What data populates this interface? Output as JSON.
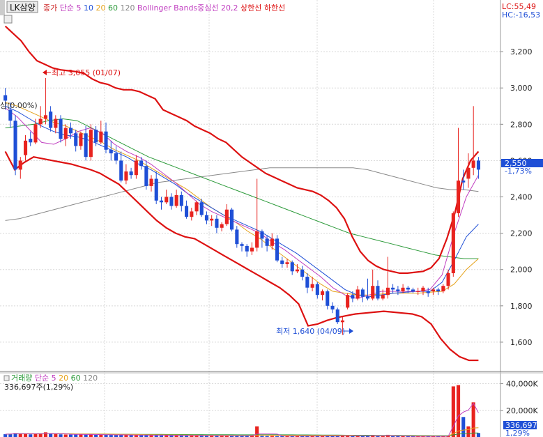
{
  "price_panel": {
    "stock_name": "LK삼양",
    "legend": [
      {
        "text": "종가",
        "color": "#cc2222"
      },
      {
        "text": "단순",
        "color": "#c03ec0"
      },
      {
        "text": "5",
        "color": "#c03ec0"
      },
      {
        "text": "10",
        "color": "#1f4fd6"
      },
      {
        "text": "20",
        "color": "#e5a21a"
      },
      {
        "text": "60",
        "color": "#2c9a3a"
      },
      {
        "text": "120",
        "color": "#888888"
      },
      {
        "text": "Bollinger Bands중심선 20,2",
        "color": "#c03ec0"
      },
      {
        "text": "상한선",
        "color": "#dd1111"
      },
      {
        "text": "하한선",
        "color": "#dd1111"
      }
    ],
    "lc_label": "LC:55,49",
    "hc_label": "HC:-16,53",
    "cursor_label": "상(0.00%)",
    "max_annotation": "최고 3,055 (01/07)",
    "min_annotation": "최저 1,640 (04/09)",
    "current_price": "2,550",
    "current_change": "-1,73%",
    "y_ticks": [
      "3,200",
      "3,000",
      "2,800",
      "2,600",
      "2,400",
      "2,200",
      "2,000",
      "1,800",
      "1,600"
    ]
  },
  "volume_panel": {
    "legend": [
      {
        "text": "거래량",
        "color": "#2c9a3a"
      },
      {
        "text": "단순",
        "color": "#c03ec0"
      },
      {
        "text": "5",
        "color": "#c03ec0"
      },
      {
        "text": "20",
        "color": "#e5a21a"
      },
      {
        "text": "60",
        "color": "#2c9a3a"
      },
      {
        "text": "120",
        "color": "#888888"
      }
    ],
    "volume_readout": "336,697주(1,29%)",
    "y_ticks": [
      "40,000K",
      "20,000K"
    ],
    "current_volume": "336,697",
    "current_ratio": "1,29%"
  },
  "chart_data": {
    "type": "candlestick",
    "price_ylim": [
      1450,
      3400
    ],
    "volume_ylim": [
      0,
      45000
    ],
    "colors": {
      "up": "#e8231f",
      "down": "#1f4fd6",
      "ma5": "#c03ec0",
      "ma10": "#1f4fd6",
      "ma20": "#e5a21a",
      "ma60": "#2c9a3a",
      "ma120": "#888888",
      "bb_upper": "#dd1111",
      "bb_lower": "#dd1111"
    },
    "candles": [
      [
        2960,
        2930,
        3000,
        2880
      ],
      [
        2880,
        2820,
        2920,
        2780
      ],
      [
        2820,
        2550,
        2850,
        2520
      ],
      [
        2550,
        2600,
        2620,
        2500
      ],
      [
        2630,
        2710,
        2740,
        2600
      ],
      [
        2720,
        2700,
        2760,
        2680
      ],
      [
        2700,
        2800,
        2830,
        2690
      ],
      [
        2800,
        2830,
        2900,
        2780
      ],
      [
        2830,
        2850,
        3055,
        2800
      ],
      [
        2870,
        2780,
        2900,
        2760
      ],
      [
        2780,
        2830,
        2850,
        2750
      ],
      [
        2830,
        2720,
        2850,
        2700
      ],
      [
        2720,
        2780,
        2800,
        2680
      ],
      [
        2780,
        2750,
        2810,
        2720
      ],
      [
        2750,
        2680,
        2770,
        2650
      ],
      [
        2680,
        2750,
        2760,
        2660
      ],
      [
        2750,
        2620,
        2790,
        2600
      ],
      [
        2620,
        2770,
        2800,
        2600
      ],
      [
        2770,
        2700,
        2790,
        2680
      ],
      [
        2700,
        2760,
        2820,
        2690
      ],
      [
        2760,
        2660,
        2810,
        2640
      ],
      [
        2660,
        2640,
        2710,
        2600
      ],
      [
        2640,
        2600,
        2680,
        2580
      ],
      [
        2600,
        2490,
        2650,
        2480
      ],
      [
        2490,
        2540,
        2580,
        2470
      ],
      [
        2540,
        2520,
        2560,
        2500
      ],
      [
        2520,
        2600,
        2630,
        2500
      ],
      [
        2600,
        2570,
        2620,
        2550
      ],
      [
        2570,
        2460,
        2600,
        2440
      ],
      [
        2460,
        2500,
        2520,
        2430
      ],
      [
        2500,
        2380,
        2540,
        2360
      ],
      [
        2380,
        2370,
        2400,
        2330
      ],
      [
        2370,
        2400,
        2440,
        2360
      ],
      [
        2400,
        2350,
        2420,
        2330
      ],
      [
        2350,
        2410,
        2440,
        2340
      ],
      [
        2410,
        2350,
        2430,
        2320
      ],
      [
        2350,
        2290,
        2380,
        2280
      ],
      [
        2290,
        2320,
        2340,
        2270
      ],
      [
        2320,
        2370,
        2380,
        2300
      ],
      [
        2370,
        2300,
        2390,
        2290
      ],
      [
        2300,
        2270,
        2320,
        2250
      ],
      [
        2270,
        2280,
        2300,
        2240
      ],
      [
        2280,
        2230,
        2300,
        2200
      ],
      [
        2230,
        2250,
        2260,
        2210
      ],
      [
        2250,
        2330,
        2360,
        2240
      ],
      [
        2330,
        2220,
        2340,
        2210
      ],
      [
        2220,
        2140,
        2240,
        2120
      ],
      [
        2140,
        2130,
        2150,
        2100
      ],
      [
        2130,
        2100,
        2140,
        2070
      ],
      [
        2100,
        2120,
        2150,
        2080
      ],
      [
        2120,
        2210,
        2500,
        2100
      ],
      [
        2210,
        2170,
        2220,
        2120
      ],
      [
        2170,
        2130,
        2190,
        2100
      ],
      [
        2130,
        2170,
        2200,
        2110
      ],
      [
        2170,
        2050,
        2190,
        2040
      ],
      [
        2050,
        2030,
        2070,
        2010
      ],
      [
        2030,
        2040,
        2060,
        2010
      ],
      [
        2040,
        1990,
        2050,
        1970
      ],
      [
        1990,
        2000,
        2030,
        1980
      ],
      [
        2000,
        1960,
        2020,
        1940
      ],
      [
        1960,
        1900,
        1980,
        1870
      ],
      [
        1900,
        1920,
        1960,
        1880
      ],
      [
        1920,
        1860,
        1930,
        1840
      ],
      [
        1860,
        1880,
        1890,
        1830
      ],
      [
        1880,
        1800,
        1890,
        1780
      ],
      [
        1800,
        1780,
        1820,
        1760
      ],
      [
        1780,
        1710,
        1790,
        1700
      ],
      [
        1710,
        1720,
        1740,
        1640
      ],
      [
        1790,
        1860,
        1870,
        1780
      ],
      [
        1860,
        1840,
        1880,
        1820
      ],
      [
        1840,
        1890,
        1910,
        1830
      ],
      [
        1890,
        1850,
        1900,
        1820
      ],
      [
        1850,
        1840,
        1950,
        1830
      ],
      [
        1840,
        1910,
        2000,
        1830
      ],
      [
        1910,
        1840,
        1940,
        1830
      ],
      [
        1840,
        1860,
        1890,
        1830
      ],
      [
        1860,
        1900,
        2070,
        1840
      ],
      [
        1900,
        1890,
        1920,
        1870
      ],
      [
        1890,
        1880,
        1910,
        1860
      ],
      [
        1880,
        1900,
        1920,
        1870
      ],
      [
        1900,
        1890,
        1910,
        1870
      ],
      [
        1890,
        1880,
        1900,
        1870
      ],
      [
        1880,
        1880,
        1900,
        1860
      ],
      [
        1880,
        1900,
        1910,
        1860
      ],
      [
        1880,
        1870,
        1900,
        1850
      ],
      [
        1880,
        1890,
        1900,
        1860
      ],
      [
        1890,
        1880,
        1900,
        1860
      ],
      [
        1880,
        1910,
        1920,
        1870
      ],
      [
        1910,
        1980,
        2000,
        1890
      ],
      [
        1980,
        2310,
        2320,
        1960
      ],
      [
        2310,
        2490,
        2780,
        2290
      ],
      [
        2490,
        2480,
        2550,
        2440
      ],
      [
        2500,
        2560,
        2640,
        2450
      ],
      [
        2560,
        2600,
        2900,
        2520
      ],
      [
        2600,
        2550,
        2620,
        2500
      ]
    ],
    "bb_upper": [
      3340,
      3300,
      3260,
      3200,
      3150,
      3130,
      3110,
      3100,
      3095,
      3090,
      3080,
      3050,
      3030,
      3020,
      3000,
      2990,
      2990,
      2980,
      2960,
      2940,
      2880,
      2860,
      2840,
      2820,
      2790,
      2770,
      2750,
      2720,
      2700,
      2660,
      2620,
      2590,
      2560,
      2530,
      2510,
      2490,
      2470,
      2450,
      2440,
      2430,
      2410,
      2380,
      2340,
      2280,
      2180,
      2100,
      2050,
      2020,
      2000,
      1990,
      1980,
      1980,
      1985,
      1990,
      2010,
      2060,
      2170,
      2310,
      2500,
      2600,
      2650
    ],
    "bb_upper_x": [
      0,
      1,
      2,
      3,
      4,
      5,
      6,
      7,
      8,
      9,
      10,
      11,
      12,
      13,
      14,
      15,
      16,
      17,
      18,
      19,
      20,
      21,
      22,
      23,
      24,
      25,
      26,
      27,
      28,
      29,
      30,
      31,
      32,
      33,
      34,
      35,
      36,
      37,
      38,
      39,
      40,
      41,
      42,
      43,
      44,
      45,
      46,
      47,
      48,
      49,
      50,
      51,
      52,
      53,
      54,
      55,
      56,
      57,
      58,
      59,
      60
    ],
    "bb_lower": [
      2650,
      2550,
      2590,
      2620,
      2610,
      2600,
      2590,
      2580,
      2565,
      2550,
      2530,
      2500,
      2470,
      2420,
      2370,
      2320,
      2270,
      2230,
      2200,
      2180,
      2170,
      2140,
      2110,
      2080,
      2050,
      2020,
      1990,
      1960,
      1930,
      1900,
      1860,
      1810,
      1690,
      1700,
      1720,
      1735,
      1745,
      1755,
      1760,
      1765,
      1770,
      1765,
      1760,
      1755,
      1740,
      1700,
      1620,
      1560,
      1520,
      1500,
      1500
    ],
    "bb_lower_x": [
      0,
      1,
      2,
      3,
      4,
      5,
      6,
      7,
      8,
      9,
      10,
      11,
      12,
      13,
      14,
      15,
      16,
      17,
      18,
      19,
      20,
      21,
      22,
      23,
      24,
      25,
      26,
      27,
      28,
      29,
      30,
      31,
      32,
      33,
      34,
      35,
      36,
      37,
      38,
      39,
      40,
      41,
      42,
      43,
      44,
      45,
      46,
      47,
      48,
      49,
      50
    ],
    "ma5": [
      2890,
      2840,
      2770,
      2700,
      2690,
      2720,
      2760,
      2780,
      2750,
      2690,
      2650,
      2620,
      2580,
      2530,
      2480,
      2420,
      2360,
      2320,
      2290,
      2260,
      2230,
      2200,
      2150,
      2110,
      2060,
      2010,
      1960,
      1900,
      1860,
      1840,
      1860,
      1880,
      1880,
      1880,
      1880,
      1890,
      1970,
      2200,
      2400,
      2520
    ],
    "ma10": [
      2900,
      2870,
      2830,
      2790,
      2760,
      2740,
      2730,
      2710,
      2680,
      2650,
      2620,
      2580,
      2550,
      2510,
      2470,
      2420,
      2380,
      2340,
      2300,
      2270,
      2240,
      2210,
      2170,
      2130,
      2090,
      2040,
      1990,
      1940,
      1890,
      1860,
      1850,
      1860,
      1870,
      1875,
      1880,
      1880,
      1930,
      2050,
      2180,
      2250
    ],
    "ma20": [
      2920,
      2900,
      2870,
      2840,
      2810,
      2790,
      2760,
      2730,
      2700,
      2660,
      2630,
      2600,
      2560,
      2520,
      2480,
      2440,
      2390,
      2340,
      2300,
      2260,
      2210,
      2170,
      2120,
      2070,
      2020,
      1970,
      1920,
      1880,
      1870,
      1860,
      1860,
      1865,
      1870,
      1870,
      1870,
      1875,
      1880,
      1920,
      2000,
      2060
    ],
    "ma60": [
      2780,
      2790,
      2800,
      2820,
      2830,
      2820,
      2780,
      2740,
      2700,
      2660,
      2620,
      2590,
      2560,
      2530,
      2500,
      2470,
      2440,
      2410,
      2380,
      2350,
      2320,
      2290,
      2260,
      2230,
      2200,
      2180,
      2160,
      2140,
      2120,
      2100,
      2080,
      2070,
      2060,
      2060
    ],
    "ma120": [
      2270,
      2280,
      2300,
      2320,
      2340,
      2360,
      2380,
      2400,
      2420,
      2440,
      2460,
      2480,
      2490,
      2500,
      2510,
      2520,
      2530,
      2540,
      2550,
      2560,
      2560,
      2560,
      2560,
      2560,
      2560,
      2560,
      2550,
      2530,
      2510,
      2490,
      2470,
      2450,
      2440,
      2440,
      2430
    ],
    "volume": [
      2100,
      2400,
      3000,
      2600,
      2300,
      2000,
      2500,
      2700,
      3500,
      2500,
      2100,
      2000,
      1900,
      1800,
      1900,
      2000,
      1800,
      1900,
      1700,
      1600,
      1700,
      1500,
      1400,
      1800,
      1500,
      1400,
      1300,
      1400,
      1500,
      1300,
      1400,
      1200,
      1300,
      1100,
      1200,
      1100,
      1000,
      1100,
      1000,
      1200,
      1000,
      900,
      1000,
      900,
      1000,
      1000,
      900,
      900,
      800,
      900,
      8000,
      900,
      800,
      800,
      700,
      700,
      700,
      700,
      800,
      700,
      800,
      700,
      700,
      800,
      900,
      700,
      800,
      1200,
      900,
      700,
      800,
      700,
      900,
      1500,
      700,
      600,
      1600,
      600,
      500,
      500,
      500,
      500,
      500,
      500,
      500,
      500,
      500,
      500,
      900,
      38000,
      39000,
      15000,
      8000,
      26000,
      3000
    ]
  }
}
